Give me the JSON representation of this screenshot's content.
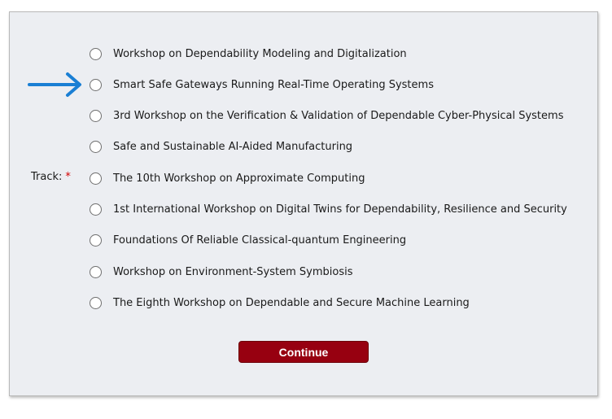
{
  "form": {
    "field_label": "Track:",
    "required_marker": "*",
    "options": [
      {
        "label": "Workshop on Dependability Modeling and Digitalization"
      },
      {
        "label": "Smart Safe Gateways Running Real-Time Operating Systems"
      },
      {
        "label": "3rd Workshop on the Verification & Validation of Dependable Cyber-Physical Systems"
      },
      {
        "label": "Safe and Sustainable AI-Aided Manufacturing"
      },
      {
        "label": "The 10th Workshop on Approximate Computing"
      },
      {
        "label": "1st International Workshop on Digital Twins for Dependability, Resilience and Security"
      },
      {
        "label": "Foundations Of Reliable Classical-quantum Engineering"
      },
      {
        "label": "Workshop on Environment-System Symbiosis"
      },
      {
        "label": "The Eighth Workshop on Dependable and Secure Machine Learning"
      }
    ],
    "continue_label": "Continue"
  },
  "annotation": {
    "icon": "arrow-right-icon",
    "color": "#1a7fd4"
  },
  "colors": {
    "button": "#970010",
    "required": "#d40000",
    "panel": "#eceef2"
  }
}
